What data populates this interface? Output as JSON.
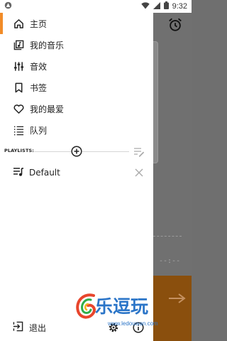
{
  "status_bar": {
    "time": "9:32"
  },
  "nav": {
    "items": [
      {
        "label": "主页",
        "icon": "home-icon"
      },
      {
        "label": "我的音乐",
        "icon": "music-library-icon"
      },
      {
        "label": "音效",
        "icon": "equalizer-icon"
      },
      {
        "label": "书签",
        "icon": "bookmark-icon"
      },
      {
        "label": "我的最爱",
        "icon": "heart-icon"
      },
      {
        "label": "队列",
        "icon": "queue-icon"
      }
    ]
  },
  "playlists": {
    "header": "PLAYLISTS:",
    "items": [
      {
        "label": "Default"
      }
    ]
  },
  "footer": {
    "exit_label": "退出"
  },
  "background": {
    "time_placeholder": "--:--"
  },
  "watermark": {
    "text": "乐逗玩",
    "url": "www.ledouwan.com"
  },
  "colors": {
    "accent": "#f28c28",
    "background_orange": "#8a4f0d",
    "watermark": "#2b75c8"
  }
}
